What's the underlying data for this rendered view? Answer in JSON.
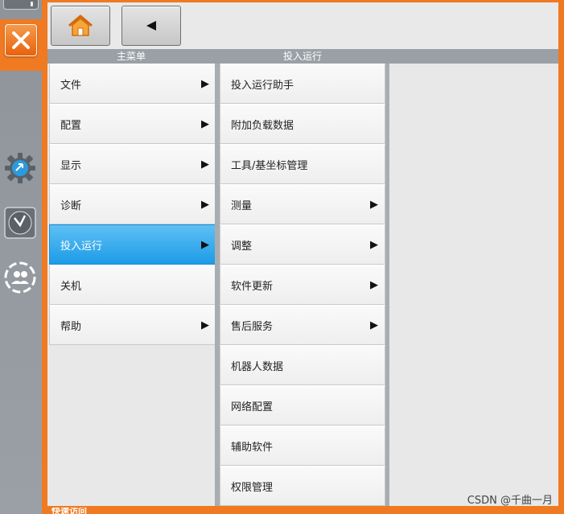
{
  "headers": {
    "main_menu": "主菜单",
    "submenu": "投入运行"
  },
  "main_menu": [
    {
      "label": "文件",
      "has_submenu": true,
      "active": false
    },
    {
      "label": "配置",
      "has_submenu": true,
      "active": false
    },
    {
      "label": "显示",
      "has_submenu": true,
      "active": false
    },
    {
      "label": "诊断",
      "has_submenu": true,
      "active": false
    },
    {
      "label": "投入运行",
      "has_submenu": true,
      "active": true
    },
    {
      "label": "关机",
      "has_submenu": false,
      "active": false
    },
    {
      "label": "帮助",
      "has_submenu": true,
      "active": false
    }
  ],
  "submenu": [
    {
      "label": "投入运行助手",
      "has_submenu": false
    },
    {
      "label": "附加负载数据",
      "has_submenu": false
    },
    {
      "label": "工具/基坐标管理",
      "has_submenu": false
    },
    {
      "label": "测量",
      "has_submenu": true
    },
    {
      "label": "调整",
      "has_submenu": true
    },
    {
      "label": "软件更新",
      "has_submenu": true
    },
    {
      "label": "售后服务",
      "has_submenu": true
    },
    {
      "label": "机器人数据",
      "has_submenu": false
    },
    {
      "label": "网络配置",
      "has_submenu": false
    },
    {
      "label": "辅助软件",
      "has_submenu": false
    },
    {
      "label": "权限管理",
      "has_submenu": false
    }
  ],
  "toolbar": {
    "home_icon": "home-icon",
    "back_icon": "back-triangle-icon"
  },
  "sidebar_icons": [
    "close-icon",
    "gear-icon",
    "clock-icon",
    "user-group-icon"
  ],
  "bottom_text": "快速访问",
  "watermark": "CSDN @千曲一月",
  "colors": {
    "accent": "#ef7a22",
    "active_item": "#2aa6ec",
    "header_bar": "#9aa0a6"
  }
}
